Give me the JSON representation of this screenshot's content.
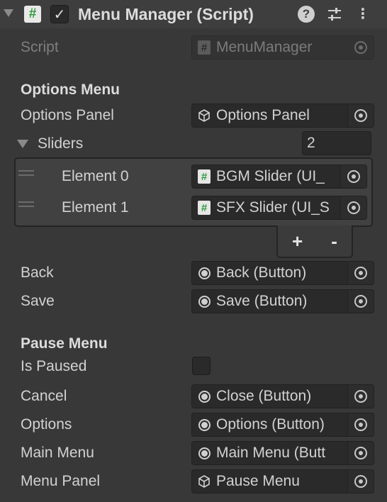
{
  "header": {
    "title": "Menu Manager (Script)",
    "enabled": true,
    "help_glyph": "?",
    "settings_glyph": "⚙",
    "more_glyph": "⋮"
  },
  "script_field": {
    "label": "Script",
    "value": "MenuManager",
    "icon": "script-icon"
  },
  "options_section": {
    "title": "Options Menu",
    "options_panel": {
      "label": "Options Panel",
      "value": "Options Panel",
      "icon": "gameobject-icon"
    },
    "sliders": {
      "label": "Sliders",
      "size": "2",
      "elements": [
        {
          "label": "Element 0",
          "value": "BGM Slider (UI_",
          "icon": "script-icon"
        },
        {
          "label": "Element 1",
          "value": "SFX Slider (UI_S",
          "icon": "script-icon"
        }
      ],
      "add_label": "+",
      "remove_label": "-"
    },
    "back": {
      "label": "Back",
      "value": "Back (Button)",
      "icon": "button-icon"
    },
    "save": {
      "label": "Save",
      "value": "Save (Button)",
      "icon": "button-icon"
    }
  },
  "pause_section": {
    "title": "Pause Menu",
    "is_paused": {
      "label": "Is Paused",
      "checked": false
    },
    "cancel": {
      "label": "Cancel",
      "value": "Close (Button)",
      "icon": "button-icon"
    },
    "options": {
      "label": "Options",
      "value": "Options (Button)",
      "icon": "button-icon"
    },
    "main_menu": {
      "label": "Main Menu",
      "value": "Main Menu (Butt",
      "icon": "button-icon"
    },
    "menu_panel": {
      "label": "Menu Panel",
      "value": "Pause Menu",
      "icon": "gameobject-icon"
    }
  },
  "colors": {
    "background": "#383838",
    "header": "#3e3e3e",
    "field": "#2a2a2a",
    "script_green": "#2f9a3c"
  }
}
